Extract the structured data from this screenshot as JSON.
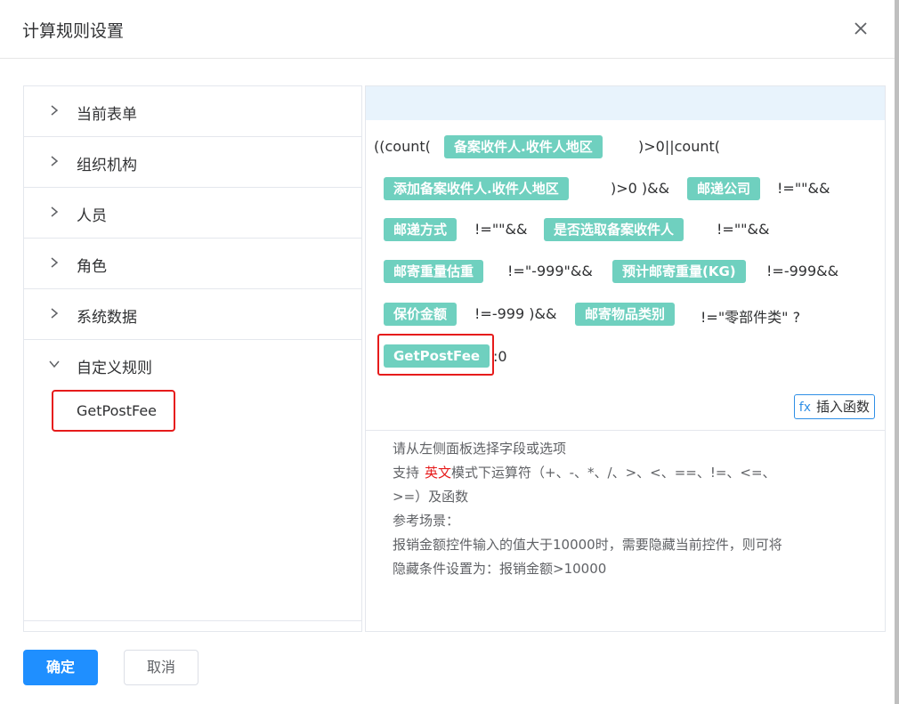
{
  "dialog": {
    "title": "计算规则设置",
    "close_icon": "close-icon"
  },
  "left_panel": {
    "items": [
      {
        "label": "当前表单",
        "icon": "chevron-right-icon"
      },
      {
        "label": "组织机构",
        "icon": "chevron-right-icon"
      },
      {
        "label": "人员",
        "icon": "chevron-right-icon"
      },
      {
        "label": "角色",
        "icon": "chevron-right-icon"
      },
      {
        "label": "系统数据",
        "icon": "chevron-right-icon"
      },
      {
        "label": "自定义规则",
        "icon": "chevron-down-icon"
      }
    ],
    "child": {
      "label": "GetPostFee"
    }
  },
  "formula": {
    "text_1": "((count(",
    "chip_1": "备案收件人.收件人地区",
    "text_2": ")>0||count(",
    "chip_2": "添加备案收件人.收件人地区",
    "text_3": ")>0 )&&",
    "chip_3": "邮递公司",
    "text_4": "!=\"\"&&",
    "chip_4": "邮递方式",
    "text_5": "!=\"\"&&",
    "chip_5": "是否选取备案收件人",
    "text_6": "!=\"\"&&",
    "chip_6": "邮寄重量估重",
    "text_7": "!=\"-999\"&&",
    "chip_7": "预计邮寄重量(KG)",
    "text_8": "!=-999&&",
    "chip_8": "保价金额",
    "text_9": "!=-999 )&&",
    "chip_9": "邮寄物品类别",
    "text_10": "!=\"零部件类\" ?",
    "chip_10": "GetPostFee",
    "text_11": ":0"
  },
  "insert_function": {
    "icon_text": "fx",
    "label": "插入函数"
  },
  "hint": {
    "line1": "请从左侧面板选择字段或选项",
    "line2_pre": "支持",
    "line2_red": "英文",
    "line2_post": "模式下运算符（+、-、*、/、>、<、==、!=、<=、",
    "line3": ">=）及函数",
    "line4": "参考场景：",
    "line5": "报销金额控件输入的值大于10000时，需要隐藏当前控件，则可将",
    "line6": "隐藏条件设置为：报销金额>10000"
  },
  "footer": {
    "confirm": "确定",
    "cancel": "取消"
  },
  "colors": {
    "chip": "#6fd0bf",
    "primary": "#1f8fff",
    "highlight_border": "#e61b1b"
  }
}
